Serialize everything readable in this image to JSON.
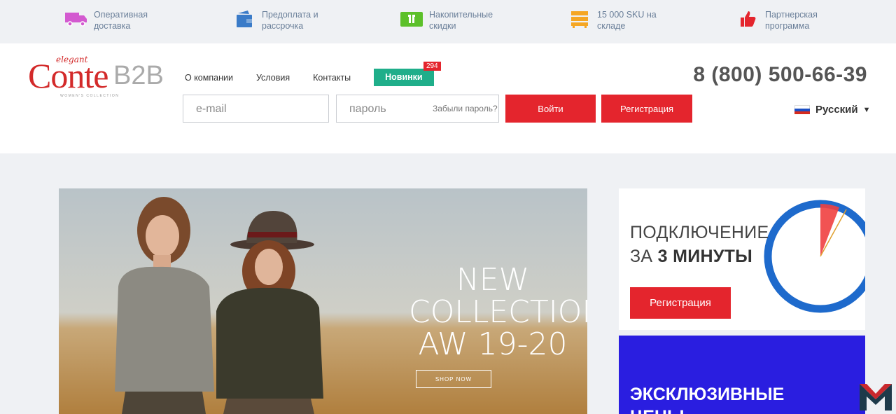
{
  "features": [
    {
      "icon": "truck-icon",
      "text": "Оперативная доставка",
      "color": "#d35ad0"
    },
    {
      "icon": "wallet-icon",
      "text": "Предоплата и рассрочка",
      "color": "#3a7bc8"
    },
    {
      "icon": "gift-icon",
      "text": "Накопительные скидки",
      "color": "#5cc02a"
    },
    {
      "icon": "stack-icon",
      "text": "15 000 SKU на складе",
      "color": "#f5a623"
    },
    {
      "icon": "thumbs-up-icon",
      "text": "Партнерская программа",
      "color": "#e4252d"
    }
  ],
  "logo": {
    "elegant": "elegant",
    "conte": "Conte",
    "b2b": "B2B",
    "subtitle": "WOMEN'S COLLECTION"
  },
  "nav": {
    "items": [
      "О компании",
      "Условия",
      "Контакты"
    ],
    "novinki": "Новинки",
    "badge": "294"
  },
  "phone": "8 (800) 500-66-39",
  "login": {
    "email_placeholder": "e-mail",
    "password_placeholder": "пароль",
    "forgot": "Забыли пароль?",
    "login_btn": "Войти",
    "register_btn": "Регистрация"
  },
  "language": {
    "selected": "Русский"
  },
  "banner": {
    "line1": "NEW",
    "line2": "COLLECTION",
    "line3": "AW 19-20",
    "cta": "SHOP NOW"
  },
  "promo": {
    "line1": "ПОДКЛЮЧЕНИЕ",
    "line2_prefix": "ЗА",
    "line2_bold": "3 МИНУТЫ",
    "button": "Регистрация"
  },
  "promo2": {
    "line1": "ЭКСКЛЮЗИВНЫЕ",
    "line2": "ЦЕНЫ"
  },
  "colors": {
    "accent_red": "#e4252d",
    "accent_green": "#1fae8a",
    "card_blue": "#2a1ee0"
  }
}
